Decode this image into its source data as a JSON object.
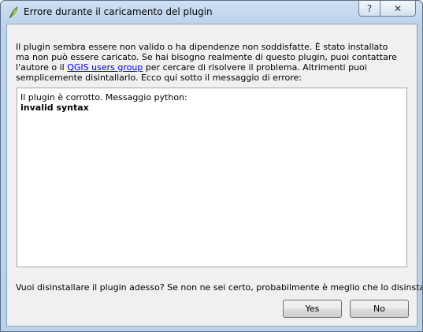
{
  "window": {
    "title": "Errore durante il caricamento del plugin",
    "help_label": "?",
    "close_label": "✕"
  },
  "message": {
    "part1": "Il plugin sembra essere non valido o ha dipendenze non soddisfatte. È stato installato ma non può essere caricato. Se hai bisogno realmente di questo plugin, puoi contattare l'autore o il ",
    "link": "QGIS users group",
    "part2": " per cercare di risolvere il problema. Altrimenti puoi semplicemente disintallarlo. Ecco qui sotto il messaggio di errore:"
  },
  "error_box": {
    "line1": "Il plugin è corrotto. Messaggio python:",
    "line2": "invalid syntax"
  },
  "question": "Vuoi disinstallare il plugin adesso? Se non ne sei certo, probabilmente è meglio che lo disinstalli.",
  "buttons": {
    "yes": "Yes",
    "no": "No"
  }
}
